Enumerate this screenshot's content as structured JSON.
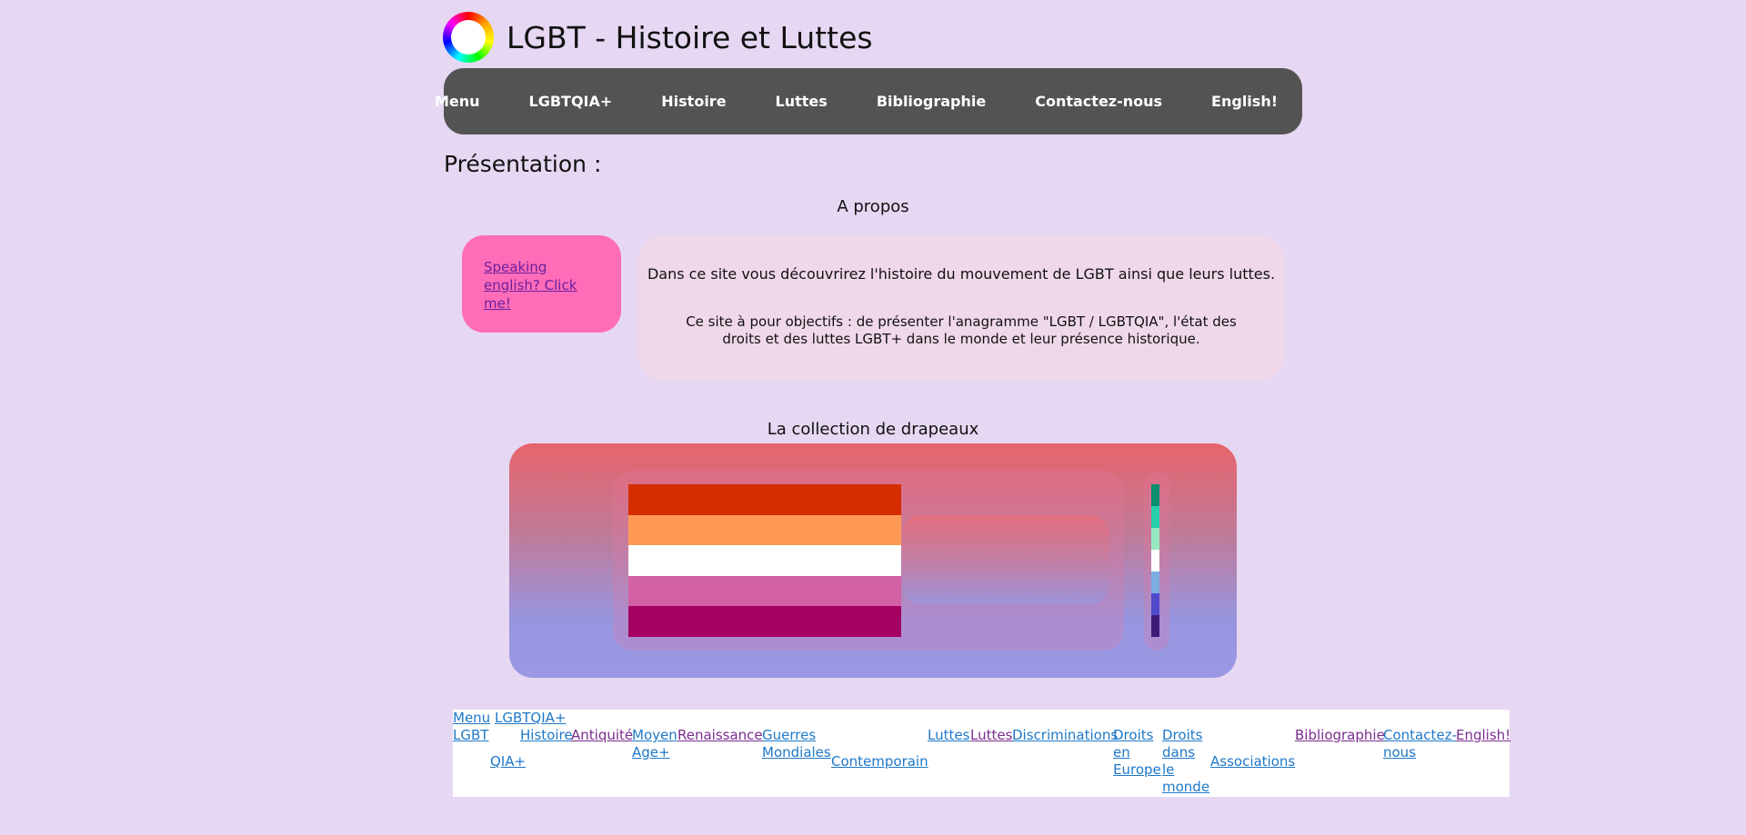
{
  "site": {
    "title": "LGBT - Histoire et Luttes"
  },
  "nav": [
    {
      "label": "Menu"
    },
    {
      "label": "LGBTQIA+"
    },
    {
      "label": "Histoire"
    },
    {
      "label": "Luttes"
    },
    {
      "label": "Bibliographie"
    },
    {
      "label": "Contactez-nous"
    },
    {
      "label": "English!"
    }
  ],
  "presentation": {
    "title": "Présentation :",
    "about_heading": "A propos",
    "english_link": "Speaking english? Click me!",
    "line1": "Dans ce site vous découvrirez l'histoire du mouvement de LGBT ainsi que leurs luttes.",
    "line2": "Ce site à pour objectifs : de présenter l'anagramme \"LGBT / LGBTQIA\", l'état des droits et des luttes LGBT+ dans le monde et leur présence historique."
  },
  "flags": {
    "heading": "La collection de drapeaux",
    "main_flag_colors": [
      "#d52d00",
      "#ff9a56",
      "#ffffff",
      "#d362a4",
      "#a30262"
    ],
    "side_flag_colors": [
      "#078d70",
      "#26ceaa",
      "#98e8c1",
      "#ffffff",
      "#7bade2",
      "#5049cc",
      "#3d1a78"
    ]
  },
  "footer": {
    "links": {
      "menu": "Menu",
      "lgbt": "LGBT",
      "lgbtqia": "LGBTQIA+",
      "qia": "QIA+",
      "histoire": "Histoire",
      "antiquite": "Antiquité",
      "moyen": "Moyen",
      "age": "Age+",
      "renaissance": "Renaissance",
      "guerres": "Guerres",
      "mondiales": "Mondiales",
      "contemporain": "Contemporain",
      "luttes1": "Luttes",
      "luttes2": "Luttes",
      "discriminations": "Discriminations",
      "droits_europe_1": "Droits",
      "droits_europe_2": "en",
      "droits_europe_3": "Europe",
      "droits_monde_1": "Droits",
      "droits_monde_2": "dans",
      "droits_monde_3": "le",
      "droits_monde_4": "monde",
      "associations": "Associations",
      "bibliographie": "Bibliographie",
      "contactez": "Contactez-",
      "nous": "nous",
      "english": "English!"
    }
  }
}
